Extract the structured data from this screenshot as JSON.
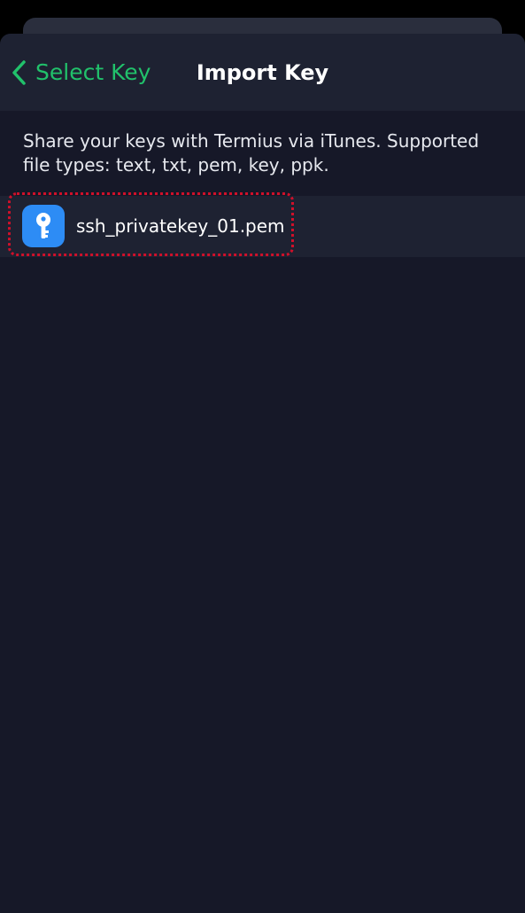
{
  "nav": {
    "back_label": "Select Key",
    "title": "Import Key"
  },
  "info": {
    "text": "Share your keys with Termius via iTunes. Supported file types: text, txt, pem, key, ppk."
  },
  "files": [
    {
      "name": "ssh_privatekey_01.pem",
      "icon": "key-icon"
    }
  ],
  "colors": {
    "accent": "#21c16b",
    "background": "#161828",
    "nav_background": "#1e2232",
    "file_icon": "#2d8cf5",
    "highlight": "#d0102a"
  }
}
